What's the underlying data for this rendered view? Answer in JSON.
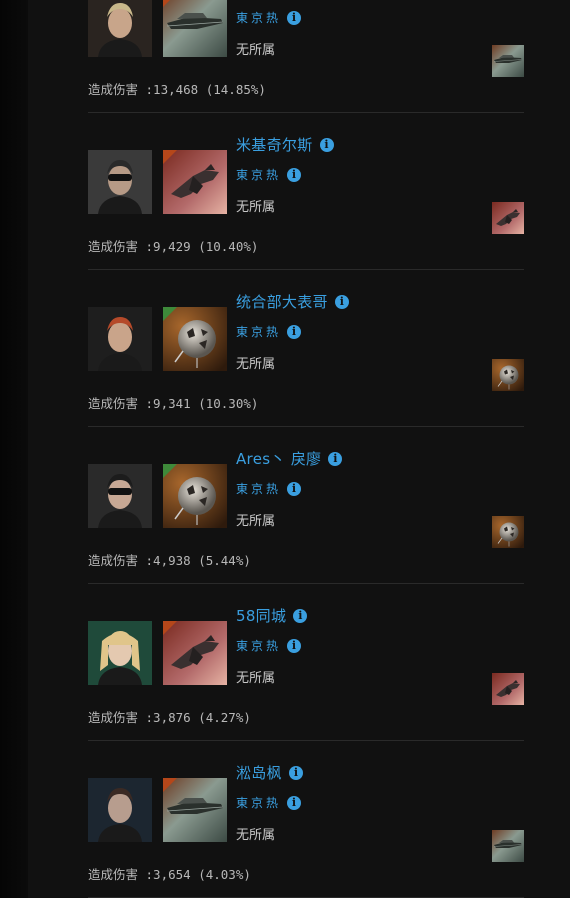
{
  "icons": {
    "info": "info-circle-icon"
  },
  "colors": {
    "link": "#3a9fe0",
    "separator": "#2a2a2a",
    "text": "#b8b8b8"
  },
  "entries": [
    {
      "name": "",
      "corp": "東京热",
      "alliance": "无所属",
      "damage": "造成伤害 :13,468 (14.85%)",
      "ship": "hull-gray",
      "portrait": "blonde"
    },
    {
      "name": "米基奇尔斯",
      "corp": "東京热",
      "alliance": "无所属",
      "damage": "造成伤害 :9,429 (10.40%)",
      "ship": "hull-red",
      "portrait": "goggles"
    },
    {
      "name": "统合部大表哥",
      "corp": "東京热",
      "alliance": "无所属",
      "damage": "造成伤害 :9,341 (10.30%)",
      "ship": "hull-sphere",
      "portrait": "redhair"
    },
    {
      "name": "Ares丶 戾廖",
      "corp": "東京热",
      "alliance": "无所属",
      "damage": "造成伤害 :4,938 (5.44%)",
      "ship": "hull-sphere",
      "portrait": "sunglasses"
    },
    {
      "name": "58同城",
      "corp": "東京热",
      "alliance": "无所属",
      "damage": "造成伤害 :3,876 (4.27%)",
      "ship": "hull-red",
      "portrait": "blonde2"
    },
    {
      "name": "淞岛枫",
      "corp": "東京热",
      "alliance": "无所属",
      "damage": "造成伤害 :3,654 (4.03%)",
      "ship": "hull-gray",
      "portrait": "dark"
    }
  ]
}
